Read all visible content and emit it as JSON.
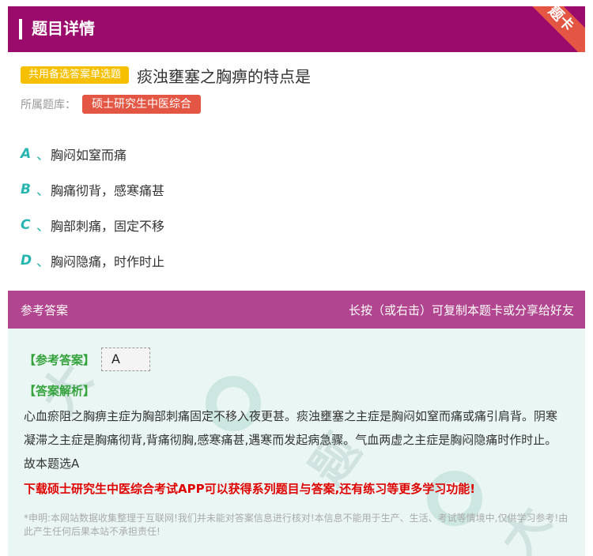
{
  "header": {
    "title": "题目详情",
    "ribbon": "题卡"
  },
  "question": {
    "type_badge": "共用备选答案单选题",
    "text": "痰浊壅塞之胸痹的特点是",
    "bank_label": "所属题库：",
    "bank_name": "硕士研究生中医综合"
  },
  "options": [
    {
      "letter": "A",
      "sep": "、",
      "text": "胸闷如窒而痛"
    },
    {
      "letter": "B",
      "sep": "、",
      "text": "胸痛彻背，感寒痛甚"
    },
    {
      "letter": "C",
      "sep": "、",
      "text": "胸部刺痛，固定不移"
    },
    {
      "letter": "D",
      "sep": "、",
      "text": "胸闷隐痛，时作时止"
    }
  ],
  "answer_section": {
    "title": "参考答案",
    "hint": "长按（或右击）可复制本题卡或分享给好友",
    "answer_label": "【参考答案】",
    "answer_value": "A",
    "analysis_label": "【答案解析】",
    "analysis_text": "心血瘀阻之胸痹主症为胸部刺痛固定不移入夜更甚。痰浊壅塞之主症是胸闷如窒而痛或痛引肩背。阴寒凝滞之主症是胸痛彻背,背痛彻胸,感寒痛甚,遇寒而发起病急骤。气血两虚之主症是胸闷隐痛时作时止。故本题选A",
    "promo": "下载硕士研究生中医综合考试APP可以获得系列题目与答案,还有练习等更多学习功能!",
    "disclaimer": "*申明:本网站数据收集整理于互联网!我们并未能对答案信息进行核对!本信息不能用于生产、生活、考试等情境中,仅供学习参考!由此产生任何后果本站不承担责任!"
  },
  "colors": {
    "header_bg": "#9b0b6b",
    "answer_header_bg": "#b1458f",
    "answer_body_bg": "#eaf6f4",
    "badge_yellow": "#f6c000",
    "tag_red": "#e25643",
    "option_accent": "#27b5b0",
    "label_green": "#35a33c",
    "promo_red": "#e00000"
  }
}
